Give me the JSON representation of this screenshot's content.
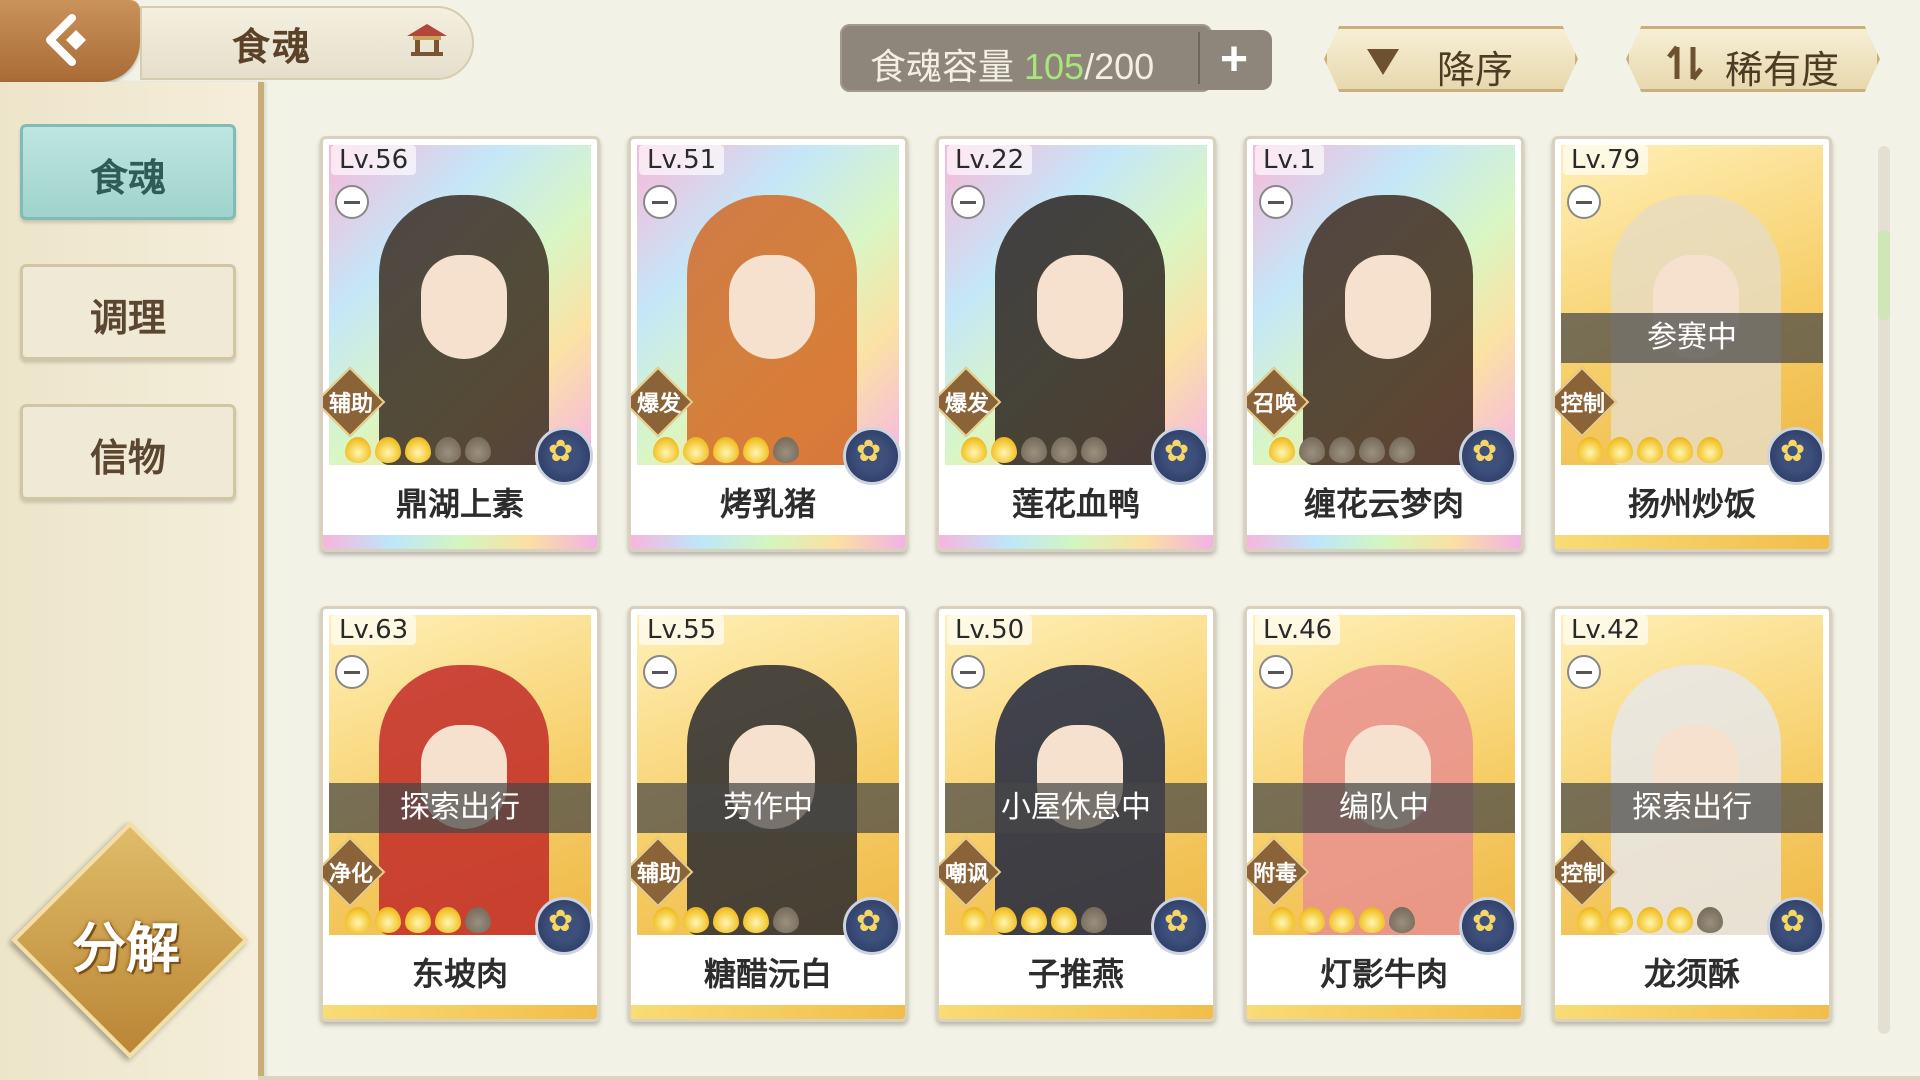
{
  "header": {
    "title": "食魂",
    "capacity": {
      "label": "食魂容量 ",
      "current": "105",
      "separator": "/",
      "max": "200"
    },
    "sort_order_label": "降序",
    "sort_key_label": "稀有度"
  },
  "sidebar": {
    "items": [
      {
        "label": "食魂",
        "active": true
      },
      {
        "label": "调理",
        "active": false
      },
      {
        "label": "信物",
        "active": false
      }
    ],
    "decompose_label": "分解"
  },
  "cards": [
    {
      "level": "Lv.56",
      "name": "鼎湖上素",
      "role": "辅助",
      "status": "",
      "stars": 3,
      "frame": "rainbow",
      "hair": "#3a2d22"
    },
    {
      "level": "Lv.51",
      "name": "烤乳猪",
      "role": "爆发",
      "status": "",
      "stars": 4,
      "frame": "rainbow",
      "hair": "#d26a24"
    },
    {
      "level": "Lv.22",
      "name": "莲花血鸭",
      "role": "爆发",
      "status": "",
      "stars": 2,
      "frame": "rainbow",
      "hair": "#2b2320"
    },
    {
      "level": "Lv.1",
      "name": "缠花云梦肉",
      "role": "召唤",
      "status": "",
      "stars": 1,
      "frame": "rainbow",
      "hair": "#3f2a1f"
    },
    {
      "level": "Lv.79",
      "name": "扬州炒饭",
      "role": "控制",
      "status": "参赛中",
      "stars": 5,
      "frame": "gold",
      "hair": "#e7dcc1"
    },
    {
      "level": "Lv.63",
      "name": "东坡肉",
      "role": "净化",
      "status": "探索出行",
      "stars": 4,
      "frame": "gold",
      "hair": "#c22a28"
    },
    {
      "level": "Lv.55",
      "name": "糖醋沅白",
      "role": "辅助",
      "status": "劳作中",
      "stars": 4,
      "frame": "gold",
      "hair": "#2a2a2f"
    },
    {
      "level": "Lv.50",
      "name": "子推燕",
      "role": "嘲讽",
      "status": "小屋休息中",
      "stars": 4,
      "frame": "gold",
      "hair": "#1f2640"
    },
    {
      "level": "Lv.46",
      "name": "灯影牛肉",
      "role": "附毒",
      "status": "编队中",
      "stars": 4,
      "frame": "gold",
      "hair": "#e9918f"
    },
    {
      "level": "Lv.42",
      "name": "龙须酥",
      "role": "控制",
      "status": "探索出行",
      "stars": 4,
      "frame": "gold",
      "hair": "#e8e8ea"
    }
  ]
}
